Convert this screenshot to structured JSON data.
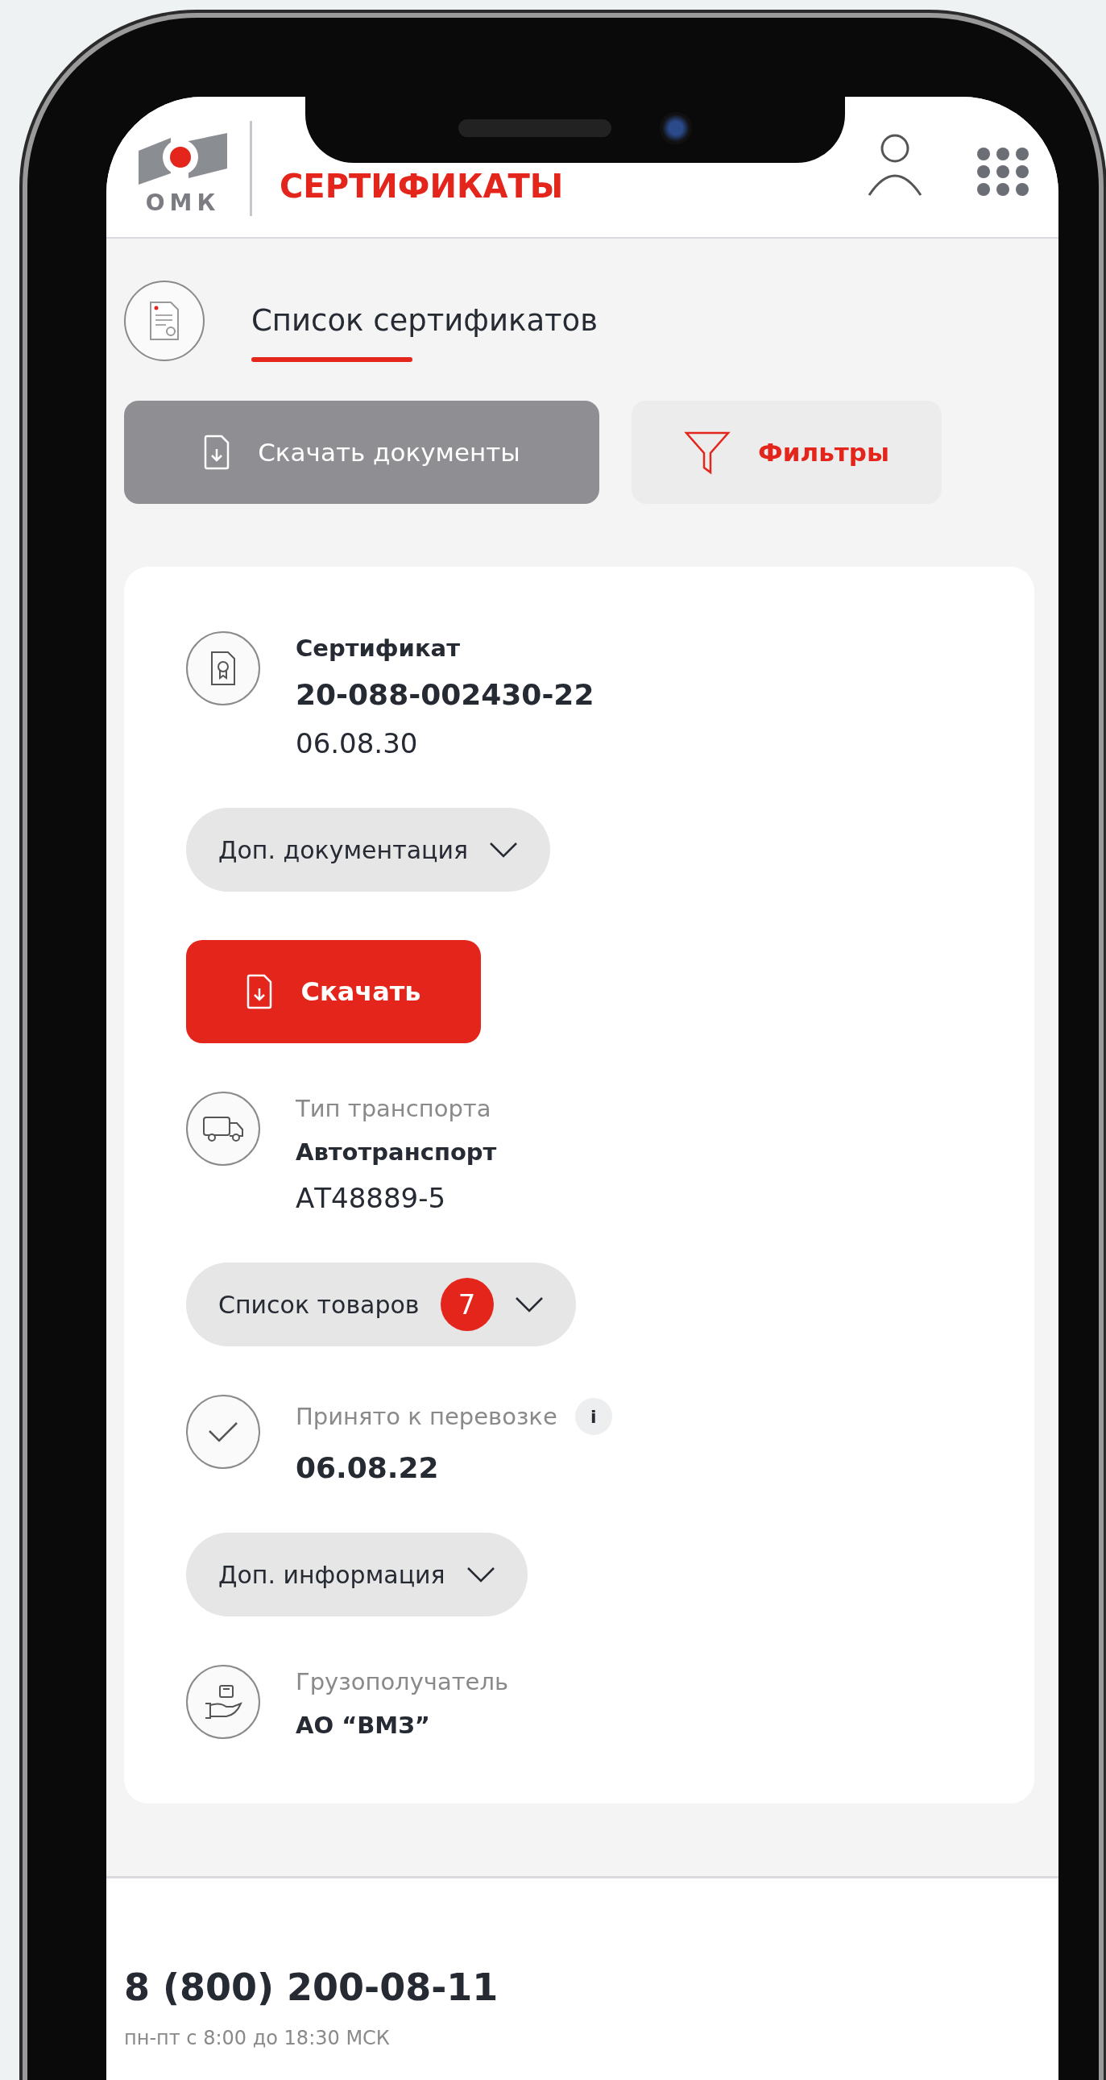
{
  "header": {
    "logo_text": "ОМК",
    "title": "СЕРТИФИКАТЫ"
  },
  "page_title": "Список сертификатов",
  "actions": [
    {
      "kind": "download",
      "label": "Скачать документы"
    },
    {
      "kind": "filter",
      "label": "Фильтры"
    }
  ],
  "card": {
    "certificate": {
      "label": "Сертификат",
      "number": "20-088-002430-22",
      "date": "06.08.30"
    },
    "docs_toggle": {
      "label": "Доп. документация",
      "expanded": false
    },
    "download_button": "Скачать",
    "transport": {
      "label": "Тип транспорта",
      "value": "Автотранспорт",
      "number": "АТ48889-5"
    },
    "goods_toggle": {
      "label": "Список товаров",
      "count": "7",
      "expanded": false
    },
    "accepted": {
      "label": "Принято к перевозке",
      "info": "i",
      "date": "06.08.22"
    },
    "info_toggle": {
      "label": "Доп. информация",
      "expanded": false
    },
    "recipient": {
      "label": "Грузополучатель",
      "value": "АО “ВМЗ”"
    }
  },
  "footer": {
    "phone": "8 (800) 200-08-11",
    "hours": "пн-пт с 8:00 до 18:30 МСК"
  }
}
